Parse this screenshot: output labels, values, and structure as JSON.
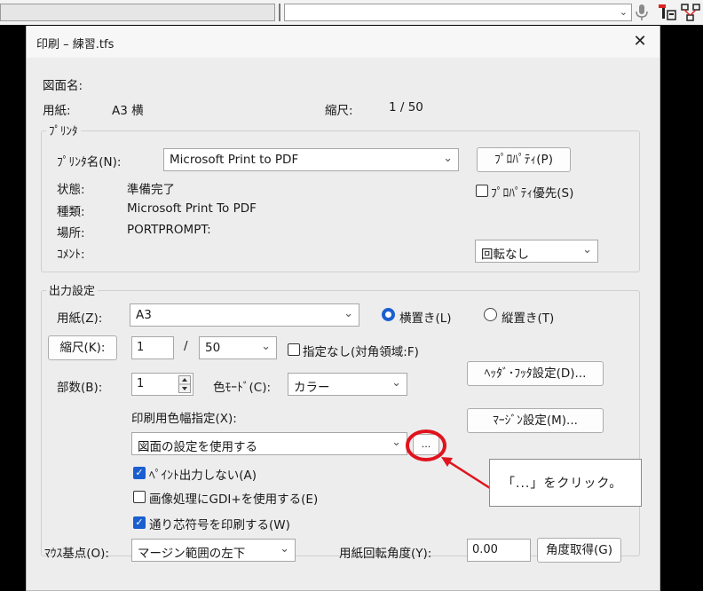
{
  "toolbar": {
    "icons": [
      "microphone-icon",
      "text-style-icon",
      "network-icon"
    ]
  },
  "dialog": {
    "title": "印刷 – 練習.tfs",
    "close": "✕",
    "drawing_name_label": "図面名:",
    "paper_label": "用紙:",
    "paper_value": "A3 横",
    "scale_label": "縮尺:",
    "scale_value": "1 / 50",
    "printer": {
      "group_title": "ﾌﾟﾘﾝﾀ",
      "name_label": "ﾌﾟﾘﾝﾀ名(N):",
      "name_value": "Microsoft Print to PDF",
      "properties_button": "ﾌﾟﾛﾊﾟﾃｨ(P)",
      "status_label": "状態:",
      "status_value": "準備完了",
      "type_label": "種類:",
      "type_value": "Microsoft Print To PDF",
      "location_label": "場所:",
      "location_value": "PORTPROMPT:",
      "comment_label": "ｺﾒﾝﾄ:",
      "property_priority_label": "ﾌﾟﾛﾊﾟﾃｨ優先(S)",
      "property_priority_checked": false,
      "rotation_value": "回転なし"
    },
    "output": {
      "group_title": "出力設定",
      "paper_label": "用紙(Z):",
      "paper_value": "A3",
      "landscape_label": "横置き(L)",
      "portrait_label": "縦置き(T)",
      "orientation": "landscape",
      "scale_button": "縮尺(K):",
      "scale_num": "1",
      "scale_slash": "/",
      "scale_den": "50",
      "unspecified_label": "指定なし(対角領域:F)",
      "unspecified_checked": false,
      "header_footer_button": "ﾍｯﾀﾞ･ﾌｯﾀ設定(D)...",
      "copies_label": "部数(B):",
      "copies_value": "1",
      "color_mode_label": "色ﾓｰﾄﾞ(C):",
      "color_mode_value": "カラー",
      "margin_button": "ﾏｰｼﾞﾝ設定(M)...",
      "line_width_label": "印刷用色幅指定(X):",
      "line_width_value": "図面の設定を使用する",
      "ellipsis_button": "...",
      "no_paint_label": "ﾍﾟｲﾝﾄ出力しない(A)",
      "no_paint_checked": true,
      "gdi_label": "画像処理にGDI+を使用する(E)",
      "gdi_checked": false,
      "grid_symbol_label": "通り芯符号を印刷する(W)",
      "grid_symbol_checked": true
    },
    "mouse_base_label": "ﾏｳｽ基点(O):",
    "mouse_base_value": "マージン範囲の左下",
    "rotation_angle_label": "用紙回転角度(Y):",
    "rotation_angle_value": "0.00",
    "get_angle_button": "角度取得(G)"
  },
  "annotation": {
    "callout_text": "「...」をクリック。",
    "highlight_color": "#e0141e"
  }
}
